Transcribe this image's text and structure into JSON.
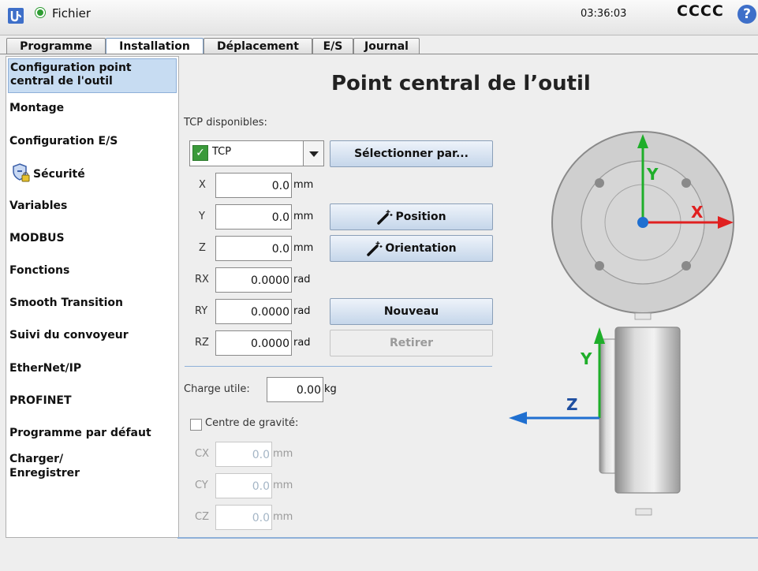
{
  "header": {
    "file_label": "Fichier",
    "clock": "03:36:03",
    "robot_name": "CCCC",
    "help_label": "?"
  },
  "tabs": [
    {
      "label": "Programme"
    },
    {
      "label": "Installation",
      "active": true
    },
    {
      "label": "Déplacement"
    },
    {
      "label": "E/S"
    },
    {
      "label": "Journal"
    }
  ],
  "sidebar": {
    "items": [
      {
        "label": "Configuration point central de l'outil",
        "selected": true
      },
      {
        "label": "Montage"
      },
      {
        "label": "Configuration E/S"
      },
      {
        "label": "Sécurité",
        "icon": "shield-lock-icon"
      },
      {
        "label": "Variables"
      },
      {
        "label": "MODBUS"
      },
      {
        "label": "Fonctions"
      },
      {
        "label": "Smooth Transition"
      },
      {
        "label": "Suivi du convoyeur"
      },
      {
        "label": "EtherNet/IP"
      },
      {
        "label": "PROFINET"
      },
      {
        "label": "Programme par défaut"
      },
      {
        "label": "Charger/ Enregistrer"
      }
    ]
  },
  "main": {
    "title": "Point central de l’outil",
    "tcp_available_label": "TCP disponibles:",
    "tcp_selected": "TCP",
    "select_by_button": "Sélectionner par...",
    "position_button": "Position",
    "orientation_button": "Orientation",
    "new_button": "Nouveau",
    "remove_button": "Retirer",
    "coords": [
      {
        "label": "X",
        "value": "0.0",
        "unit": "mm"
      },
      {
        "label": "Y",
        "value": "0.0",
        "unit": "mm"
      },
      {
        "label": "Z",
        "value": "0.0",
        "unit": "mm"
      },
      {
        "label": "RX",
        "value": "0.0000",
        "unit": "rad"
      },
      {
        "label": "RY",
        "value": "0.0000",
        "unit": "rad"
      },
      {
        "label": "RZ",
        "value": "0.0000",
        "unit": "rad"
      }
    ],
    "payload_label": "Charge utile:",
    "payload_value": "0.00",
    "payload_unit": "kg",
    "cog_label": "Centre de gravité:",
    "cog_checked": false,
    "cog": [
      {
        "label": "CX",
        "value": "0.0",
        "unit": "mm"
      },
      {
        "label": "CY",
        "value": "0.0",
        "unit": "mm"
      },
      {
        "label": "CZ",
        "value": "0.0",
        "unit": "mm"
      }
    ],
    "graphic_labels": {
      "front_y": "Y",
      "front_x": "X",
      "side_y": "Y",
      "side_z": "Z"
    }
  },
  "colors": {
    "accent": "#3e6fc9",
    "axis_x": "#e02020",
    "axis_y": "#1fae2a",
    "axis_z": "#1f6fd0",
    "selection": "#c7dcf2",
    "enabled_check": "#3a9a3a"
  }
}
